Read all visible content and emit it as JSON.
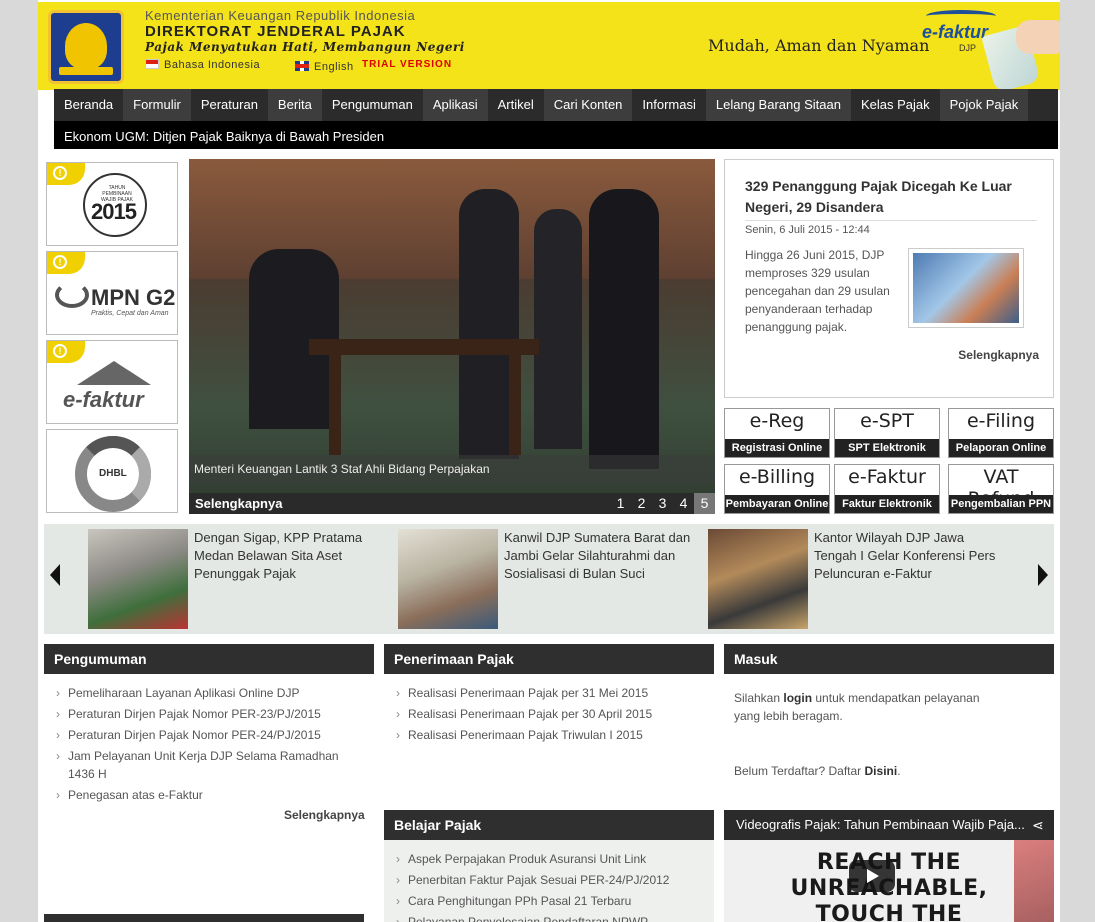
{
  "header": {
    "ministry": "Kementerian Keuangan Republik Indonesia",
    "dirjen": "DIREKTORAT JENDERAL PAJAK",
    "slogan": "Pajak Menyatukan Hati, Membangun Negeri",
    "lang_id": "Bahasa Indonesia",
    "lang_en": "English",
    "trial": "TRIAL VERSION",
    "tagline": "Mudah, Aman dan Nyaman",
    "efaktur": "e-faktur",
    "efaktur_sub": "DJP"
  },
  "nav": {
    "items": [
      "Beranda",
      "Formulir",
      "Peraturan",
      "Berita",
      "Pengumuman",
      "Aplikasi",
      "Artikel",
      "Cari Konten",
      "Informasi",
      "Lelang Barang Sitaan",
      "Kelas Pajak",
      "Pojok Pajak"
    ]
  },
  "ticker": "Ekonom UGM: Ditjen Pajak Baiknya di Bawah Presiden",
  "banners": {
    "b1_year": "2015",
    "b1_sub": "TAHUN PEMBINAAN WAJIB PAJAK",
    "b2_name": "MPN G2",
    "b2_tag": "Praktis, Cepat dan Aman",
    "b3_name": "e-faktur",
    "b4_name": "DHBL"
  },
  "slider": {
    "caption": "Menteri Keuangan Lantik 3 Staf Ahli Bidang Perpajakan",
    "more": "Selengkapnya",
    "pages": [
      "1",
      "2",
      "3",
      "4",
      "5"
    ]
  },
  "news": {
    "title": "329 Penanggung Pajak Dicegah Ke Luar Negeri, 29 Disandera",
    "date": "Senin, 6 Juli 2015 - 12:44",
    "body": "Hingga 26 Juni 2015, DJP memproses 329 usulan pencegahan dan 29 usulan penyanderaan terhadap penanggung pajak.",
    "more": "Selengkapnya"
  },
  "apps": [
    {
      "big": "e-Reg",
      "small": "Registrasi Online"
    },
    {
      "big": "e-SPT",
      "small": "SPT Elektronik"
    },
    {
      "big": "e-Filing",
      "small": "Pelaporan Online"
    },
    {
      "big": "e-Billing",
      "small": "Pembayaran Online"
    },
    {
      "big": "e-Faktur",
      "small": "Faktur Elektronik"
    },
    {
      "big": "VAT Refund",
      "small": "Pengembalian PPN"
    }
  ],
  "carousel": [
    "Dengan Sigap, KPP Pratama Medan Belawan Sita Aset Penunggak Pajak",
    "Kanwil DJP Sumatera Barat dan Jambi Gelar Silahturahmi dan Sosialisasi di Bulan Suci",
    "Kantor Wilayah DJP Jawa Tengah I Gelar Konferensi Pers Peluncuran e-Faktur"
  ],
  "pengumuman": {
    "title": "Pengumuman",
    "items": [
      "Pemeliharaan Layanan Aplikasi Online DJP",
      "Peraturan Dirjen Pajak Nomor PER-23/PJ/2015",
      "Peraturan Dirjen Pajak Nomor PER-24/PJ/2015",
      "Jam Pelayanan Unit Kerja DJP Selama Ramadhan 1436 H",
      "Penegasan atas e-Faktur"
    ],
    "more": "Selengkapnya"
  },
  "penerimaan": {
    "title": "Penerimaan Pajak",
    "items": [
      "Realisasi Penerimaan Pajak per 31 Mei 2015",
      "Realisasi Penerimaan Pajak per 30 April 2015",
      "Realisasi Penerimaan Pajak Triwulan I 2015"
    ]
  },
  "masuk": {
    "title": "Masuk",
    "t1": "Silahkan ",
    "login": "login",
    "t2": " untuk mendapatkan pelayanan yang lebih beragam.",
    "t3": "Belum Terdaftar? Daftar ",
    "disini": "Disini",
    "t4": "."
  },
  "belajar": {
    "title": "Belajar Pajak",
    "items": [
      "Aspek Perpajakan Produk Asuransi Unit Link",
      "Penerbitan Faktur Pajak Sesuai PER-24/PJ/2012",
      "Cara Penghitungan PPh Pasal 21 Terbaru",
      "Pelayanan Penyelesaian Pendaftaran NPWP"
    ]
  },
  "video": {
    "title": "Videografis Pajak: Tahun Pembinaan Wajib Paja...",
    "line1": "REACH THE UNREACHABLE,",
    "line2": "TOUCH THE UNTOUCHABLE",
    "share_icon": "share-icon",
    "play_icon": "play-icon"
  }
}
